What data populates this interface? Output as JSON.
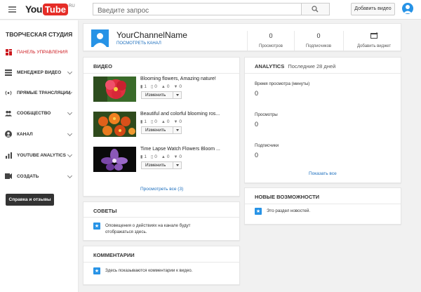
{
  "header": {
    "logo_you": "You",
    "logo_tube": "Tube",
    "logo_region": "RU",
    "search_placeholder": "Введите запрос",
    "add_video_label": "Добавить видео"
  },
  "sidebar": {
    "title": "ТВОРЧЕСКАЯ СТУДИЯ",
    "items": [
      {
        "label": "ПАНЕЛЬ УПРАВЛЕНИЯ",
        "icon": "dashboard-icon",
        "active": true
      },
      {
        "label": "МЕНЕДЖЕР ВИДЕО",
        "icon": "video-manager-icon"
      },
      {
        "label": "ПРЯМЫЕ ТРАНСЛЯЦИИ",
        "icon": "live-icon"
      },
      {
        "label": "СООБЩЕСТВО",
        "icon": "community-icon"
      },
      {
        "label": "КАНАЛ",
        "icon": "channel-icon"
      },
      {
        "label": "YOUTUBE ANALYTICS",
        "icon": "analytics-icon"
      },
      {
        "label": "СОЗДАТЬ",
        "icon": "create-icon"
      }
    ],
    "help_label": "Справка и отзывы"
  },
  "channel": {
    "name": "YourChannelName",
    "link": "ПОСМОТРЕТЬ КАНАЛ",
    "stats": [
      {
        "value": "0",
        "label": "Просмотров"
      },
      {
        "value": "0",
        "label": "Подписчиков"
      }
    ],
    "widget_label": "Добавить виджет"
  },
  "videos": {
    "title": "ВИДЕО",
    "items": [
      {
        "title": "Blooming flowers, Amazing nature!",
        "views": "1",
        "comments": "0",
        "likes": "0",
        "dislikes": "0",
        "edit": "Изменить"
      },
      {
        "title": "Beautiful and colorful blooming ros...",
        "views": "1",
        "comments": "0",
        "likes": "0",
        "dislikes": "0",
        "edit": "Изменить"
      },
      {
        "title": "Time Lapse Watch Flowers Bloom ...",
        "views": "1",
        "comments": "0",
        "likes": "0",
        "dislikes": "0",
        "edit": "Изменить"
      }
    ],
    "show_all": "Просмотреть все (3)"
  },
  "analytics": {
    "title": "ANALYTICS",
    "period": "Последние 28 дней",
    "metrics": [
      {
        "label": "Время просмотра (минуты)",
        "value": "0"
      },
      {
        "label": "Просмотры",
        "value": "0"
      },
      {
        "label": "Подписчики",
        "value": "0"
      }
    ],
    "show_all": "Показать все"
  },
  "tips": {
    "title": "СОВЕТЫ",
    "text": "Оповещения о действиях на канале будут отображаться здесь."
  },
  "whats_new": {
    "title": "НОВЫЕ ВОЗМОЖНОСТИ",
    "text": "Это раздел новостей."
  },
  "comments": {
    "title": "КОММЕНТАРИИ",
    "text": "Здесь показываются комментарии к видео."
  },
  "colors": {
    "accent_red": "#cc181e",
    "link_blue": "#1a6dbd",
    "info_blue": "#2793e6"
  }
}
